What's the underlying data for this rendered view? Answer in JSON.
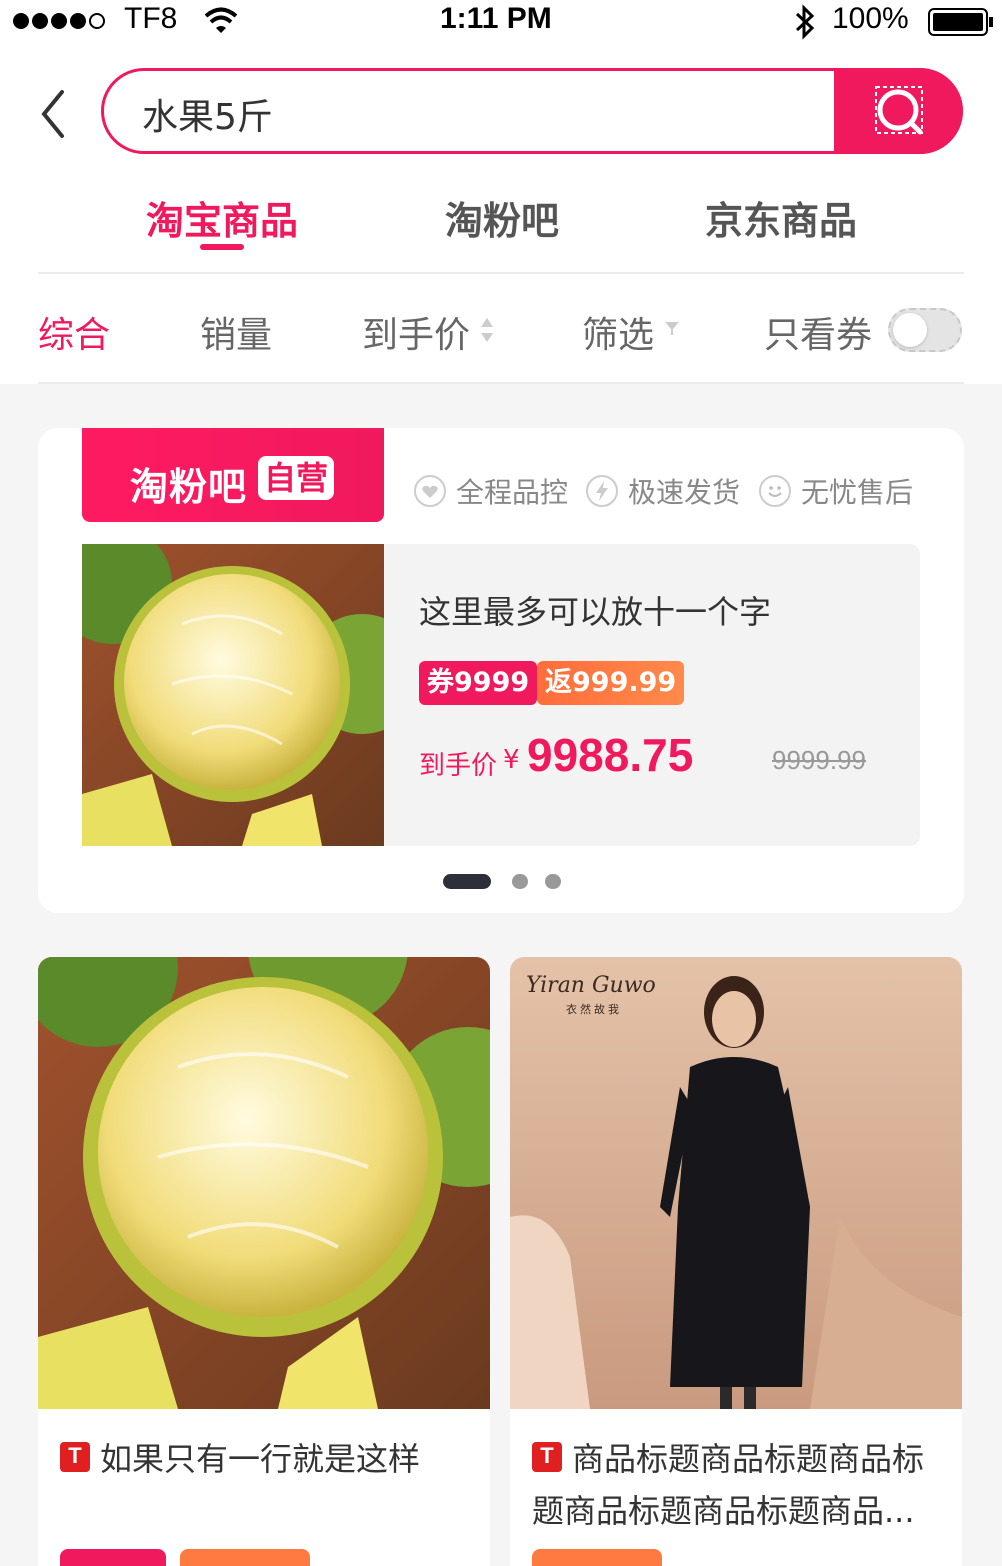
{
  "status_bar": {
    "carrier": "TF8",
    "time": "1:11 PM",
    "battery": "100%"
  },
  "search": {
    "query": "水果5斤"
  },
  "tabs": [
    {
      "label": "淘宝商品",
      "active": true
    },
    {
      "label": "淘粉吧",
      "active": false
    },
    {
      "label": "京东商品",
      "active": false
    }
  ],
  "sort": {
    "comprehensive": "综合",
    "sales": "销量",
    "final_price": "到手价",
    "filter": "筛选",
    "coupon_only": "只看券",
    "coupon_only_on": false
  },
  "feature": {
    "brand": "淘粉吧",
    "brand_self": "自营",
    "guarantees": [
      "全程品控",
      "极速发货",
      "无忧售后"
    ],
    "title": "这里最多可以放十一个字",
    "coupon_tag": "券9999",
    "rebate_tag": "返999.99",
    "price_label": "到手价",
    "price_yen": "¥",
    "price": "9988.75",
    "original_price": "9999.99",
    "carousel_active": 0
  },
  "products": [
    {
      "title": "如果只有一行就是这样",
      "platform_icon": "tmall-icon"
    },
    {
      "title": "商品标题商品标题商品标题商品标题商品标题商品...",
      "platform_icon": "tmall-icon",
      "brand_mark": "Yiran Guwo",
      "brand_sub": "衣然故我"
    }
  ],
  "colors": {
    "accent": "#f0195e",
    "rebate": "#ff7a40"
  }
}
